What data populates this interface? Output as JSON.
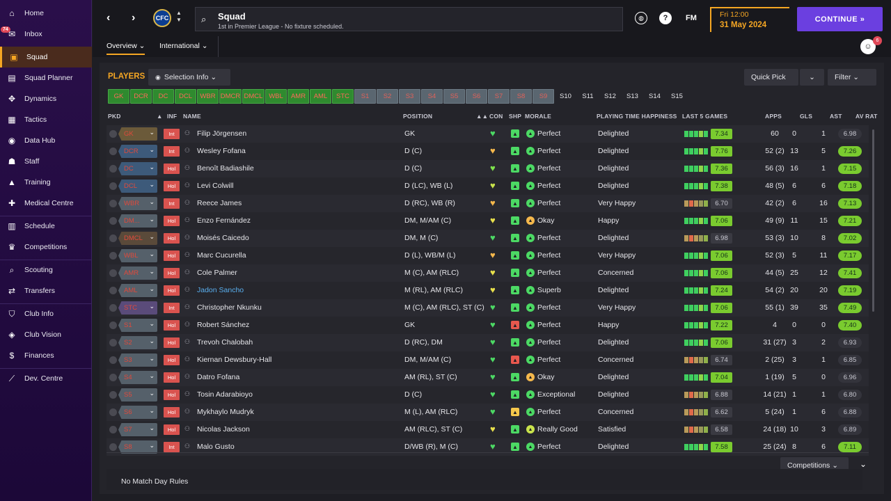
{
  "sidebar": {
    "inbox_badge": "74",
    "items": [
      {
        "label": "Home",
        "icon": "⌂"
      },
      {
        "label": "Inbox",
        "icon": "✉"
      },
      {
        "label": "Squad",
        "icon": "▣"
      },
      {
        "label": "Squad Planner",
        "icon": "▤"
      },
      {
        "label": "Dynamics",
        "icon": "✥"
      },
      {
        "label": "Tactics",
        "icon": "▦"
      },
      {
        "label": "Data Hub",
        "icon": "◉"
      },
      {
        "label": "Staff",
        "icon": "☗"
      },
      {
        "label": "Training",
        "icon": "▲"
      },
      {
        "label": "Medical Centre",
        "icon": "✚"
      },
      {
        "label": "Schedule",
        "icon": "▥"
      },
      {
        "label": "Competitions",
        "icon": "♛"
      },
      {
        "label": "Scouting",
        "icon": "⌕"
      },
      {
        "label": "Transfers",
        "icon": "⇄"
      },
      {
        "label": "Club Info",
        "icon": "⛉"
      },
      {
        "label": "Club Vision",
        "icon": "◈"
      },
      {
        "label": "Finances",
        "icon": "$"
      },
      {
        "label": "Dev. Centre",
        "icon": "⟋"
      }
    ]
  },
  "topbar": {
    "title": "Squad",
    "subtitle": "1st in Premier League - No fixture scheduled.",
    "crest_text": "CFC",
    "fm_label": "FM",
    "help_label": "?",
    "date_line1": "Fri 12:00",
    "date_line2": "31 May 2024",
    "continue_label": "CONTINUE  »",
    "profile_badge": "6"
  },
  "subtabs": {
    "overview": "Overview ⌄",
    "international": "International ⌄"
  },
  "toolbar": {
    "players_title": "PLAYERS",
    "selection_info": "Selection Info  ⌄",
    "quick_pick": "Quick Pick",
    "filter": "Filter  ⌄"
  },
  "position_chips": [
    "GK",
    "DCR",
    "DC",
    "DCL",
    "WBR",
    "DMCR",
    "DMCL",
    "WBL",
    "AMR",
    "AML",
    "STC",
    "S1",
    "S2",
    "S3",
    "S4",
    "S5",
    "S6",
    "S7",
    "S8",
    "S9",
    "S10",
    "S11",
    "S12",
    "S13",
    "S14",
    "S15"
  ],
  "headers": {
    "pkd": "PKD",
    "inf": "INF",
    "name": "NAME",
    "position": "POSITION",
    "con": "CON",
    "shp": "SHP",
    "morale": "MORALE",
    "pth": "PLAYING TIME HAPPINESS",
    "last5": "LAST 5 GAMES",
    "apps": "APPS",
    "gls": "GLS",
    "ast": "AST",
    "avrat": "AV RAT"
  },
  "players": [
    {
      "pkd": "GK",
      "inf": "Int",
      "name": "Filip Jörgensen",
      "position": "GK",
      "morale": "Perfect",
      "pth": "Delighted",
      "rating": "7.34",
      "apps": "60",
      "gls": "0",
      "ast": "1",
      "avrat": "6.98"
    },
    {
      "pkd": "DCR",
      "inf": "Int",
      "name": "Wesley Fofana",
      "position": "D (C)",
      "morale": "Perfect",
      "pth": "Delighted",
      "rating": "7.76",
      "apps": "52 (2)",
      "gls": "13",
      "ast": "5",
      "avrat": "7.26"
    },
    {
      "pkd": "DC",
      "inf": "Hol",
      "name": "Benoît Badiashile",
      "position": "D (C)",
      "morale": "Perfect",
      "pth": "Delighted",
      "rating": "7.36",
      "apps": "56 (3)",
      "gls": "16",
      "ast": "1",
      "avrat": "7.15"
    },
    {
      "pkd": "DCL",
      "inf": "Hol",
      "name": "Levi Colwill",
      "position": "D (LC), WB (L)",
      "morale": "Perfect",
      "pth": "Delighted",
      "rating": "7.38",
      "apps": "48 (5)",
      "gls": "6",
      "ast": "6",
      "avrat": "7.18"
    },
    {
      "pkd": "WBR",
      "inf": "Int",
      "name": "Reece James",
      "position": "D (RC), WB (R)",
      "morale": "Perfect",
      "pth": "Very Happy",
      "rating": "6.70",
      "apps": "42 (2)",
      "gls": "6",
      "ast": "16",
      "avrat": "7.13"
    },
    {
      "pkd": "DM...",
      "inf": "Hol",
      "name": "Enzo Fernández",
      "position": "DM, M/AM (C)",
      "morale": "Okay",
      "pth": "Happy",
      "rating": "7.06",
      "apps": "49 (9)",
      "gls": "11",
      "ast": "15",
      "avrat": "7.21"
    },
    {
      "pkd": "DMCL",
      "inf": "Hol",
      "name": "Moisés Caicedo",
      "position": "DM, M (C)",
      "morale": "Perfect",
      "pth": "Delighted",
      "rating": "6.98",
      "apps": "53 (3)",
      "gls": "10",
      "ast": "8",
      "avrat": "7.02"
    },
    {
      "pkd": "WBL",
      "inf": "Hol",
      "name": "Marc Cucurella",
      "position": "D (L), WB/M (L)",
      "morale": "Perfect",
      "pth": "Very Happy",
      "rating": "7.06",
      "apps": "52 (3)",
      "gls": "5",
      "ast": "11",
      "avrat": "7.17"
    },
    {
      "pkd": "AMR",
      "inf": "Hol",
      "name": "Cole Palmer",
      "position": "M (C), AM (RLC)",
      "morale": "Perfect",
      "pth": "Concerned",
      "rating": "7.06",
      "apps": "44 (5)",
      "gls": "25",
      "ast": "12",
      "avrat": "7.41"
    },
    {
      "pkd": "AML",
      "inf": "Hol",
      "name": "Jadon Sancho",
      "position": "M (RL), AM (RLC)",
      "morale": "Superb",
      "pth": "Delighted",
      "rating": "7.24",
      "apps": "54 (2)",
      "gls": "20",
      "ast": "20",
      "avrat": "7.19"
    },
    {
      "pkd": "STC",
      "inf": "Int",
      "name": "Christopher Nkunku",
      "position": "M (C), AM (RLC), ST (C)",
      "morale": "Perfect",
      "pth": "Very Happy",
      "rating": "7.06",
      "apps": "55 (1)",
      "gls": "39",
      "ast": "35",
      "avrat": "7.49"
    },
    {
      "pkd": "S1",
      "inf": "Hol",
      "name": "Robert Sánchez",
      "position": "GK",
      "morale": "Perfect",
      "pth": "Happy",
      "rating": "7.22",
      "apps": "4",
      "gls": "0",
      "ast": "0",
      "avrat": "7.40"
    },
    {
      "pkd": "S2",
      "inf": "Hol",
      "name": "Trevoh Chalobah",
      "position": "D (RC), DM",
      "morale": "Perfect",
      "pth": "Delighted",
      "rating": "7.06",
      "apps": "31 (27)",
      "gls": "3",
      "ast": "2",
      "avrat": "6.93"
    },
    {
      "pkd": "S3",
      "inf": "Hol",
      "name": "Kiernan Dewsbury-Hall",
      "position": "DM, M/AM (C)",
      "morale": "Perfect",
      "pth": "Concerned",
      "rating": "6.74",
      "apps": "2 (25)",
      "gls": "3",
      "ast": "1",
      "avrat": "6.85"
    },
    {
      "pkd": "S4",
      "inf": "Hol",
      "name": "Datro Fofana",
      "position": "AM (RL), ST (C)",
      "morale": "Okay",
      "pth": "Delighted",
      "rating": "7.04",
      "apps": "1 (19)",
      "gls": "5",
      "ast": "0",
      "avrat": "6.96"
    },
    {
      "pkd": "S5",
      "inf": "Hol",
      "name": "Tosin Adarabioyo",
      "position": "D (C)",
      "morale": "Exceptional",
      "pth": "Delighted",
      "rating": "6.88",
      "apps": "14 (21)",
      "gls": "1",
      "ast": "1",
      "avrat": "6.80"
    },
    {
      "pkd": "S6",
      "inf": "Hol",
      "name": "Mykhaylo Mudryk",
      "position": "M (L), AM (RLC)",
      "morale": "Perfect",
      "pth": "Concerned",
      "rating": "6.62",
      "apps": "5 (24)",
      "gls": "1",
      "ast": "6",
      "avrat": "6.88"
    },
    {
      "pkd": "S7",
      "inf": "Hol",
      "name": "Nicolas Jackson",
      "position": "AM (RLC), ST (C)",
      "morale": "Really Good",
      "pth": "Satisfied",
      "rating": "6.58",
      "apps": "24 (18)",
      "gls": "10",
      "ast": "3",
      "avrat": "6.89"
    },
    {
      "pkd": "S8",
      "inf": "Int",
      "name": "Malo Gusto",
      "position": "D/WB (R), M (C)",
      "morale": "Perfect",
      "pth": "Delighted",
      "rating": "7.58",
      "apps": "25 (24)",
      "gls": "8",
      "ast": "6",
      "avrat": "7.11"
    }
  ],
  "footer": {
    "competitions": "Competitions  ⌄",
    "no_match_day_rules": "No Match Day Rules"
  }
}
